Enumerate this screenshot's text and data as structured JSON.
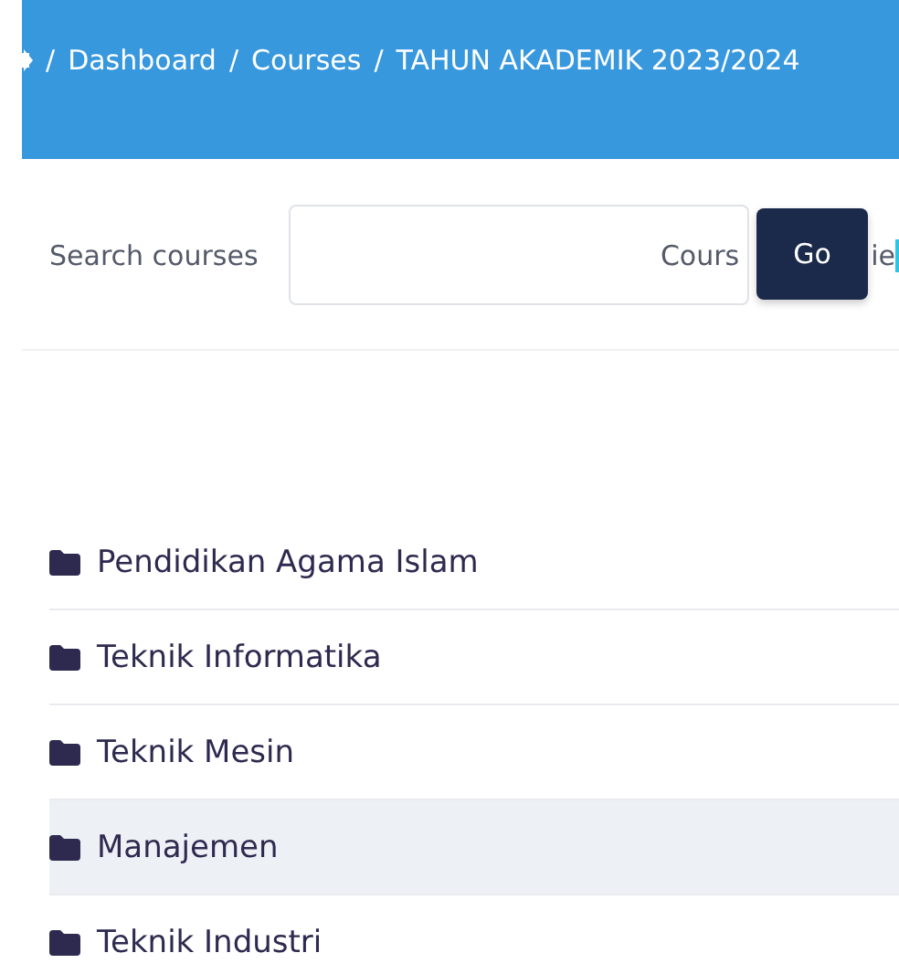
{
  "breadcrumb": [
    {
      "separator": "/",
      "label": "Dashboard"
    },
    {
      "separator": "/",
      "label": "Courses"
    },
    {
      "separator": "/",
      "label": "TAHUN AKADEMIK 2023/2024"
    }
  ],
  "search": {
    "label": "Search courses",
    "button": "Go",
    "hidden_text_left": "Cours",
    "hidden_text_right": "ie"
  },
  "categories": [
    {
      "name": "Pendidikan Agama Islam",
      "highlighted": false
    },
    {
      "name": "Teknik Informatika",
      "highlighted": false
    },
    {
      "name": "Teknik Mesin",
      "highlighted": false
    },
    {
      "name": "Manajemen",
      "highlighted": true
    },
    {
      "name": "Teknik Industri",
      "highlighted": false
    }
  ]
}
